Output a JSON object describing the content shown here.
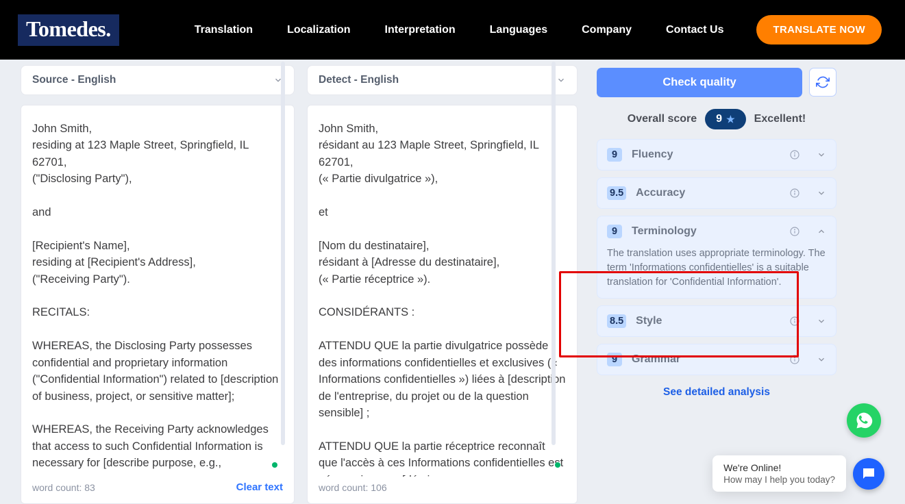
{
  "brand": "Tomedes.",
  "nav": {
    "items": [
      "Translation",
      "Localization",
      "Interpretation",
      "Languages",
      "Company",
      "Contact Us"
    ],
    "cta": "TRANSLATE NOW"
  },
  "source": {
    "lang_label": "Source - English",
    "text": "John Smith,\nresiding at 123 Maple Street, Springfield, IL 62701,\n(\"Disclosing Party\"),\n\nand\n\n[Recipient's Name],\nresiding at [Recipient's Address],\n(\"Receiving Party\").\n\nRECITALS:\n\nWHEREAS, the Disclosing Party possesses confidential and proprietary information (\"Confidential Information\") related to [description of business, project, or sensitive matter];\n\nWHEREAS, the Receiving Party acknowledges that access to such Confidential Information is necessary for [describe purpose, e.g.,",
    "word_count_label": "word count: 83",
    "clear_label": "Clear text"
  },
  "target": {
    "lang_label": "Detect - English",
    "text": "John Smith,\nrésidant au 123 Maple Street, Springfield, IL 62701,\n(« Partie divulgatrice »),\n\net\n\n[Nom du destinataire],\nrésidant à [Adresse du destinataire],\n(« Partie réceptrice »).\n\nCONSIDÉRANTS :\n\nATTENDU QUE la partie divulgatrice possède des informations confidentielles et exclusives (« Informations confidentielles ») liées à [description de l'entreprise, du projet ou de la question sensible] ;\n\nATTENDU QUE la partie réceptrice reconnaît que l'accès à ces Informations confidentielles est nécessaire pour [décrire",
    "word_count_label": "word count: 106"
  },
  "quality": {
    "check_btn": "Check quality",
    "overall_label": "Overall score",
    "overall_value": "9",
    "overall_text": "Excellent!",
    "detailed_link": "See detailed analysis",
    "metrics": [
      {
        "score": "9",
        "name": "Fluency",
        "expanded": false
      },
      {
        "score": "9.5",
        "name": "Accuracy",
        "expanded": false
      },
      {
        "score": "9",
        "name": "Terminology",
        "expanded": true,
        "body": "The translation uses appropriate terminology. The term 'Informations confidentielles' is a suitable translation for 'Confidential Information'."
      },
      {
        "score": "8.5",
        "name": "Style",
        "expanded": false
      },
      {
        "score": "9",
        "name": "Grammar",
        "expanded": false
      }
    ]
  },
  "chat": {
    "title": "We're Online!",
    "sub": "How may I help you today?"
  }
}
